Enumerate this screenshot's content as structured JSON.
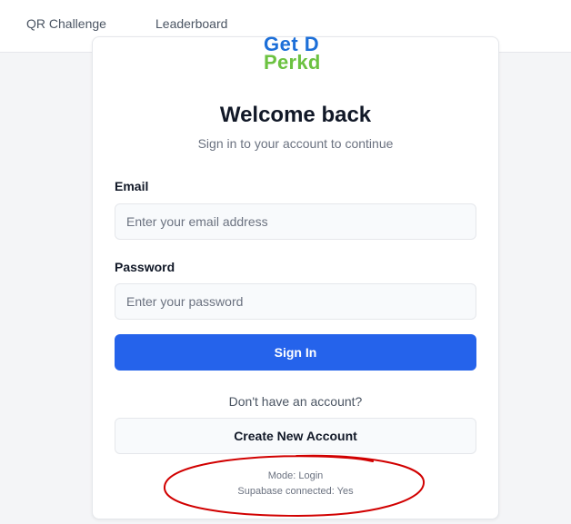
{
  "nav": {
    "items": [
      {
        "label": "QR Challenge"
      },
      {
        "label": "Leaderboard"
      }
    ]
  },
  "logo": {
    "top_text": "Get D",
    "bottom_text": "Perkd",
    "top_color": "#1d6fd8",
    "bottom_color": "#6cc241"
  },
  "form": {
    "title": "Welcome back",
    "subtitle": "Sign in to your account to continue",
    "email": {
      "label": "Email",
      "placeholder": "Enter your email address",
      "value": ""
    },
    "password": {
      "label": "Password",
      "placeholder": "Enter your password",
      "value": ""
    },
    "sign_in_label": "Sign In",
    "no_account_text": "Don't have an account?",
    "create_account_label": "Create New Account"
  },
  "status": {
    "mode": "Mode: Login",
    "connection": "Supabase connected: Yes"
  },
  "annotation": {
    "color": "#d10000"
  },
  "colors": {
    "primary": "#2563eb",
    "background": "#f4f5f7"
  }
}
